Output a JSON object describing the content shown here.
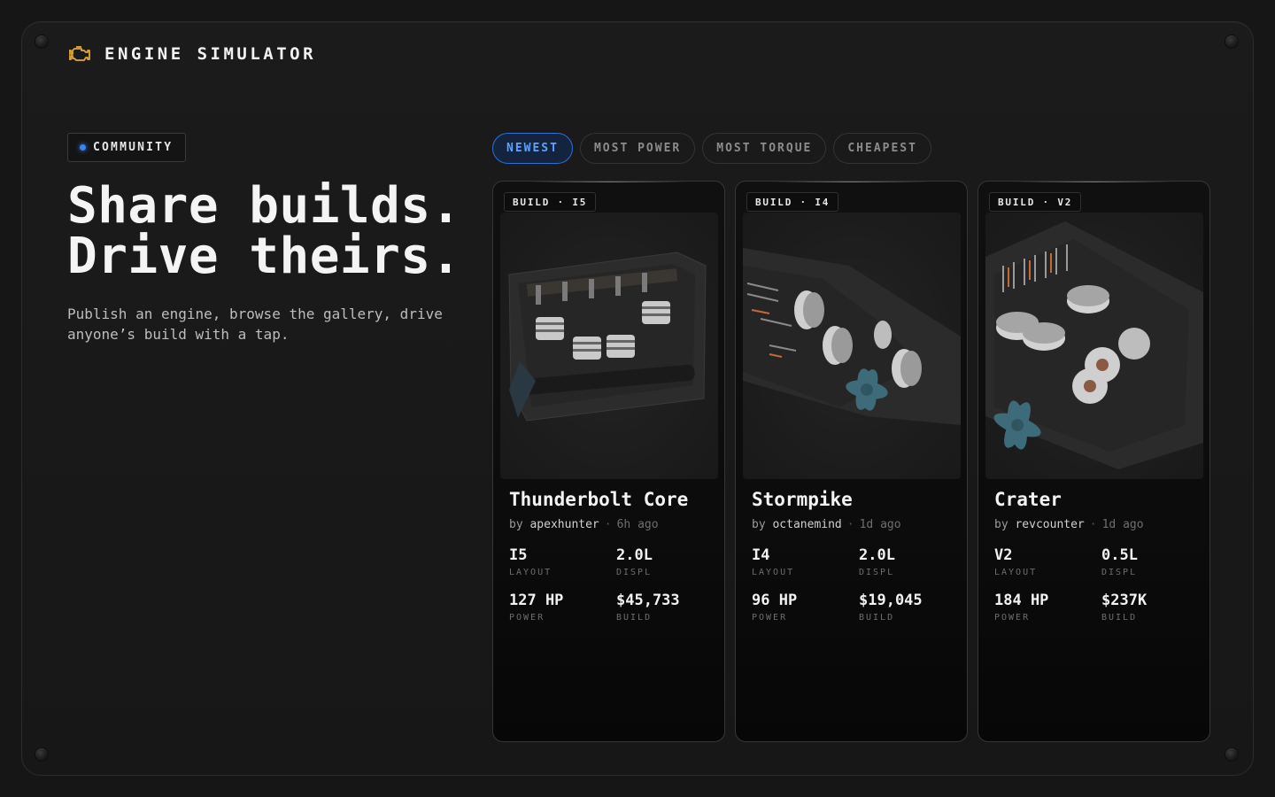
{
  "app": {
    "title": "ENGINE SIMULATOR",
    "icon": "check-engine-icon",
    "accent": "#3b82f6",
    "icon_color": "#e0a83a"
  },
  "hero": {
    "badge": "COMMUNITY",
    "headline_line1": "Share builds.",
    "headline_line2": "Drive theirs.",
    "subtext": "Publish an engine, browse the gallery, drive anyone’s build with a tap."
  },
  "sort_tabs": [
    {
      "label": "NEWEST",
      "active": true
    },
    {
      "label": "MOST POWER",
      "active": false
    },
    {
      "label": "MOST TORQUE",
      "active": false
    },
    {
      "label": "CHEAPEST",
      "active": false
    }
  ],
  "builds": [
    {
      "tag": "BUILD · I5",
      "name": "Thunderbolt Core",
      "by": "by",
      "author": "apexhunter",
      "sep": "·",
      "time": "6h ago",
      "stats": [
        {
          "value": "I5",
          "label": "LAYOUT"
        },
        {
          "value": "2.0L",
          "label": "DISPL"
        },
        {
          "value": "127 HP",
          "label": "POWER"
        },
        {
          "value": "$45,733",
          "label": "BUILD"
        }
      ]
    },
    {
      "tag": "BUILD · I4",
      "name": "Stormpike",
      "by": "by",
      "author": "octanemind",
      "sep": "·",
      "time": "1d ago",
      "stats": [
        {
          "value": "I4",
          "label": "LAYOUT"
        },
        {
          "value": "2.0L",
          "label": "DISPL"
        },
        {
          "value": "96 HP",
          "label": "POWER"
        },
        {
          "value": "$19,045",
          "label": "BUILD"
        }
      ]
    },
    {
      "tag": "BUILD · V2",
      "name": "Crater",
      "by": "by",
      "author": "revcounter",
      "sep": "·",
      "time": "1d ago",
      "stats": [
        {
          "value": "V2",
          "label": "LAYOUT"
        },
        {
          "value": "0.5L",
          "label": "DISPL"
        },
        {
          "value": "184 HP",
          "label": "POWER"
        },
        {
          "value": "$237K",
          "label": "BUILD"
        }
      ]
    }
  ]
}
